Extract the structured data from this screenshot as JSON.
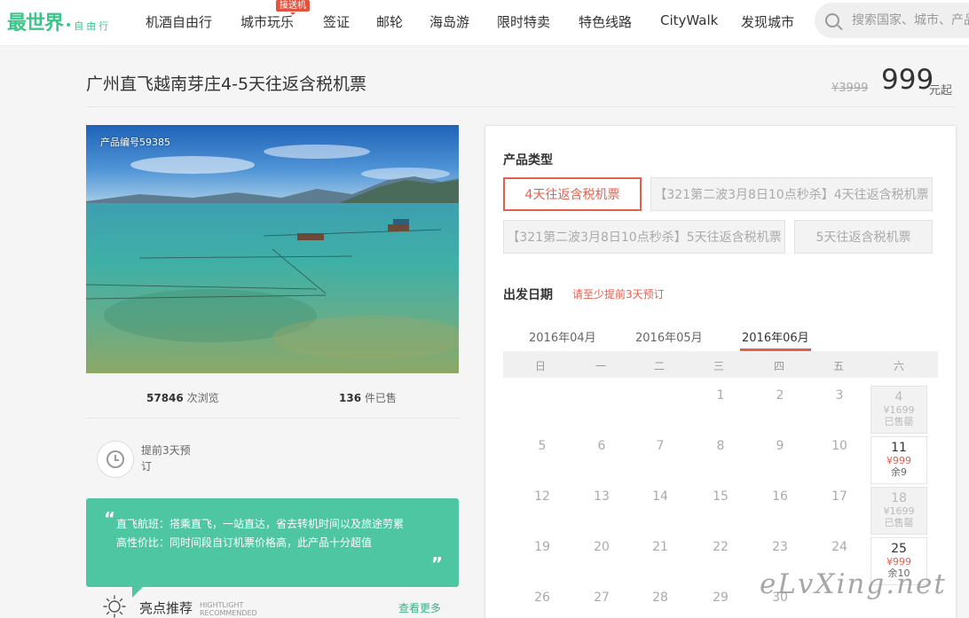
{
  "nav": {
    "logo_main": "最世界",
    "logo_sub": "自由行",
    "items": [
      "机酒自由行",
      "城市玩乐",
      "签证",
      "邮轮",
      "海岛游",
      "限时特卖",
      "特色线路",
      "CityWalk",
      "发现城市"
    ],
    "badge": "接送机",
    "search_placeholder": "搜索国家、城市、产品"
  },
  "product": {
    "title": "广州直飞越南芽庄4-5天往返含税机票",
    "old_price": "¥3999",
    "price": "999",
    "price_unit": "元起",
    "product_id": "产品编号59385",
    "views_count": "57846",
    "views_label": "次浏览",
    "sold_count": "136",
    "sold_label": "件已售",
    "advance": "提前3天预订"
  },
  "quote": {
    "open_mark": "“",
    "close_mark": "”",
    "lines": [
      "直飞航班：搭乘直飞，一站直达，省去转机时间以及旅途劳累",
      "高性价比：同时间段自订机票价格高，此产品十分超值"
    ]
  },
  "highlight": {
    "title": "亮点推荐",
    "en_line1": "HIGHTLIGHT",
    "en_line2": "RECOMMENDED",
    "more": "查看更多"
  },
  "booking": {
    "type_label": "产品类型",
    "options": [
      "4天往返含税机票",
      "【321第二波3月8日10点秒杀】4天往返含税机票",
      "【321第二波3月8日10点秒杀】5天往返含税机票",
      "5天往返含税机票"
    ],
    "selected_option": "4天往返含税机票",
    "date_label": "出发日期",
    "date_hint": "请至少提前3天预订",
    "months": [
      "2016年04月",
      "2016年05月",
      "2016年06月"
    ],
    "active_month": "2016年06月",
    "weekdays": [
      "日",
      "一",
      "二",
      "三",
      "四",
      "五",
      "六"
    ],
    "plain_days": [
      "1",
      "2",
      "3",
      "5",
      "6",
      "7",
      "8",
      "9",
      "10",
      "12",
      "13",
      "14",
      "15",
      "16",
      "17",
      "19",
      "20",
      "21",
      "22",
      "23",
      "24",
      "26",
      "27",
      "28",
      "29",
      "30"
    ],
    "priced_days": [
      {
        "day": "4",
        "price": "¥1699",
        "status": "已售罄"
      },
      {
        "day": "11",
        "price": "¥999",
        "status": "余9"
      },
      {
        "day": "18",
        "price": "¥1699",
        "status": "已售罄"
      },
      {
        "day": "25",
        "price": "¥999",
        "status": "余10"
      }
    ]
  },
  "watermark": "eLvXing.net",
  "colors": {
    "brand": "#3cc58a",
    "accent": "#e3604f",
    "quote_bg": "#4fc6a2"
  }
}
